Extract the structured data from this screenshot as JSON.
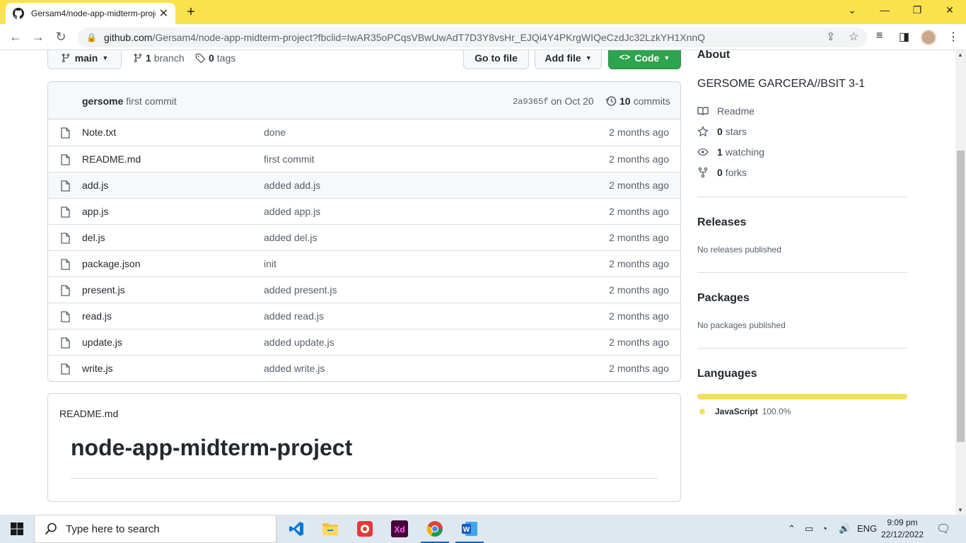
{
  "browser": {
    "tab_title": "Gersam4/node-app-midterm-project",
    "url_host": "github.com",
    "url_rest": "/Gersam4/node-app-midterm-project?fbclid=IwAR35oPCqsVBwUwAdT7D3Y8vsHr_EJQi4Y4PKrgWIQeCzdJc32LzkYH1XnnQ"
  },
  "repo_bar": {
    "branch_button": "main",
    "branch_count": "1",
    "branch_label": "branch",
    "tag_count": "0",
    "tag_label": "tags",
    "go_to_file": "Go to file",
    "add_file": "Add file",
    "code": "Code"
  },
  "commit": {
    "author": "gersome",
    "message": "first commit",
    "sha": "2a9365f",
    "date": "on Oct 20",
    "count": "10",
    "count_label": "commits"
  },
  "files": [
    {
      "name": "Note.txt",
      "message": "done",
      "age": "2 months ago"
    },
    {
      "name": "README.md",
      "message": "first commit",
      "age": "2 months ago"
    },
    {
      "name": "add.js",
      "message": "added add.js",
      "age": "2 months ago"
    },
    {
      "name": "app.js",
      "message": "added app.js",
      "age": "2 months ago"
    },
    {
      "name": "del.js",
      "message": "added del.js",
      "age": "2 months ago"
    },
    {
      "name": "package.json",
      "message": "init",
      "age": "2 months ago"
    },
    {
      "name": "present.js",
      "message": "added present.js",
      "age": "2 months ago"
    },
    {
      "name": "read.js",
      "message": "added read.js",
      "age": "2 months ago"
    },
    {
      "name": "update.js",
      "message": "added update.js",
      "age": "2 months ago"
    },
    {
      "name": "write.js",
      "message": "added write.js",
      "age": "2 months ago"
    }
  ],
  "readme": {
    "file_label": "README.md",
    "heading": "node-app-midterm-project"
  },
  "about": {
    "title": "About",
    "description": "GERSOME GARCERA//BSIT 3-1",
    "readme_link": "Readme",
    "stars_count": "0",
    "stars_label": "stars",
    "watching_count": "1",
    "watching_label": "watching",
    "forks_count": "0",
    "forks_label": "forks"
  },
  "releases": {
    "title": "Releases",
    "text": "No releases published"
  },
  "packages": {
    "title": "Packages",
    "text": "No packages published"
  },
  "languages": {
    "title": "Languages",
    "items": [
      {
        "name": "JavaScript",
        "percent": "100.0%",
        "color": "#f1e05a"
      }
    ]
  },
  "taskbar": {
    "search_placeholder": "Type here to search",
    "language": "ENG",
    "time": "9:09 pm",
    "date": "22/12/2022"
  },
  "colors": {
    "chrome_tab_bar": "#fbe24c",
    "code_button": "#2da44e",
    "javascript": "#f1e05a"
  }
}
